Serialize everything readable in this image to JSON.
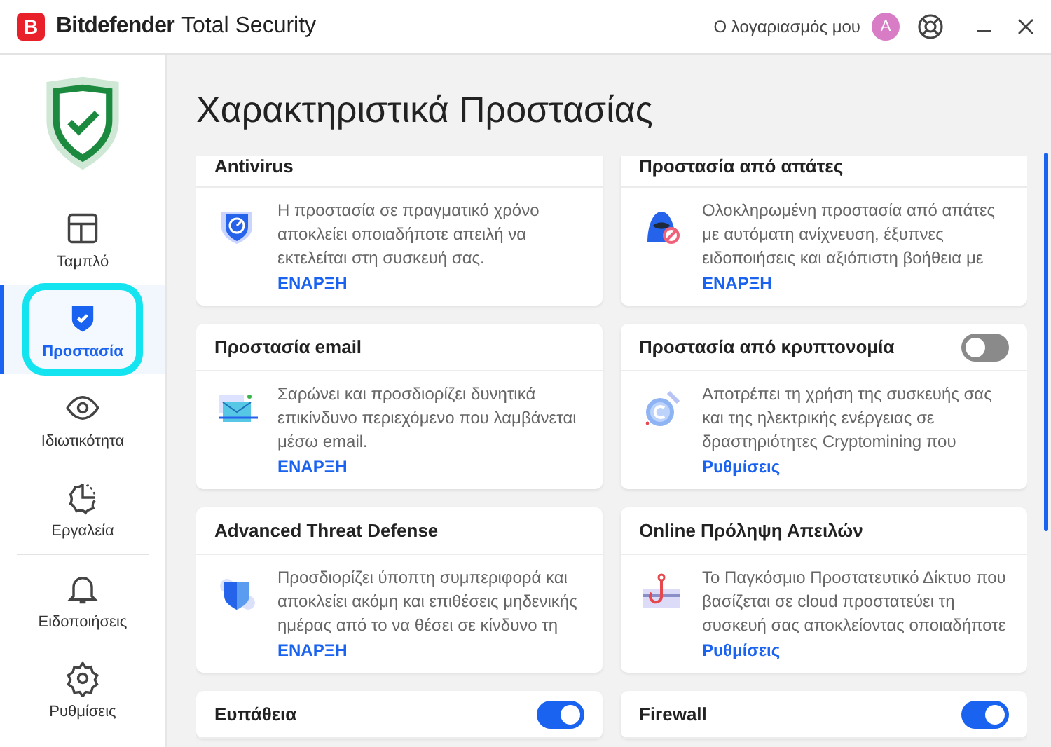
{
  "titlebar": {
    "logo_letter": "B",
    "brand": "Bitdefender",
    "product": "Total Security",
    "account": "Ο λογαριασμός μου",
    "avatar": "A"
  },
  "sidebar": {
    "items": [
      {
        "label": "Ταμπλό",
        "kind": "dashboard",
        "selected": false
      },
      {
        "label": "Προστασία",
        "kind": "shield",
        "selected": true
      },
      {
        "label": "Ιδιωτικότητα",
        "kind": "eye",
        "selected": false
      },
      {
        "label": "Εργαλεία",
        "kind": "tools",
        "selected": false
      },
      {
        "label": "Ειδοποιήσεις",
        "kind": "bell",
        "selected": false
      },
      {
        "label": "Ρυθμίσεις",
        "kind": "gear",
        "selected": false
      }
    ]
  },
  "page_title": "Χαρακτηριστικά Προστασίας",
  "cards": [
    {
      "title": "Antivirus",
      "kind": "antivirus",
      "description": "Η προστασία σε πραγματικό χρόνο αποκλείει οποιαδήποτε απειλή να εκτελείται στη συσκευή σας.",
      "link": "ΕΝΑΡΞΗ"
    },
    {
      "title": "Προστασία από απάτες",
      "kind": "scam",
      "description": "Ολοκληρωμένη προστασία από απάτες με αυτόματη ανίχνευση, έξυπνες ειδοποιήσεις και αξιόπιστη βοήθεια με",
      "link": "ΕΝΑΡΞΗ"
    },
    {
      "title": "Προστασία email",
      "kind": "email",
      "description": "Σαρώνει και προσδιορίζει δυνητικά επικίνδυνο περιεχόμενο που λαμβάνεται μέσω email.",
      "link": "ΕΝΑΡΞΗ"
    },
    {
      "title": "Προστασία από κρυπτονομία",
      "kind": "crypto",
      "on": false,
      "description": "Αποτρέπει τη χρήση της συσκευής σας και της ηλεκτρικής ενέργειας σε δραστηριότητες Cryptomining που",
      "link": "Ρυθμίσεις"
    },
    {
      "title": "Advanced Threat Defense",
      "kind": "atd",
      "description": "Προσδιορίζει ύποπτη συμπεριφορά και αποκλείει ακόμη και επιθέσεις μηδενικής ημέρας από το να θέσει σε κίνδυνο τη",
      "link": "ΕΝΑΡΞΗ"
    },
    {
      "title": "Online Πρόληψη Απειλών",
      "kind": "hook",
      "description": "Το Παγκόσμιο Προστατευτικό Δίκτυο που βασίζεται σε cloud προστατεύει τη συσκευή σας αποκλείοντας οποιαδήποτε",
      "link": "Ρυθμίσεις"
    },
    {
      "title": "Ευπάθεια",
      "on": true
    },
    {
      "title": "Firewall",
      "on": true
    }
  ]
}
